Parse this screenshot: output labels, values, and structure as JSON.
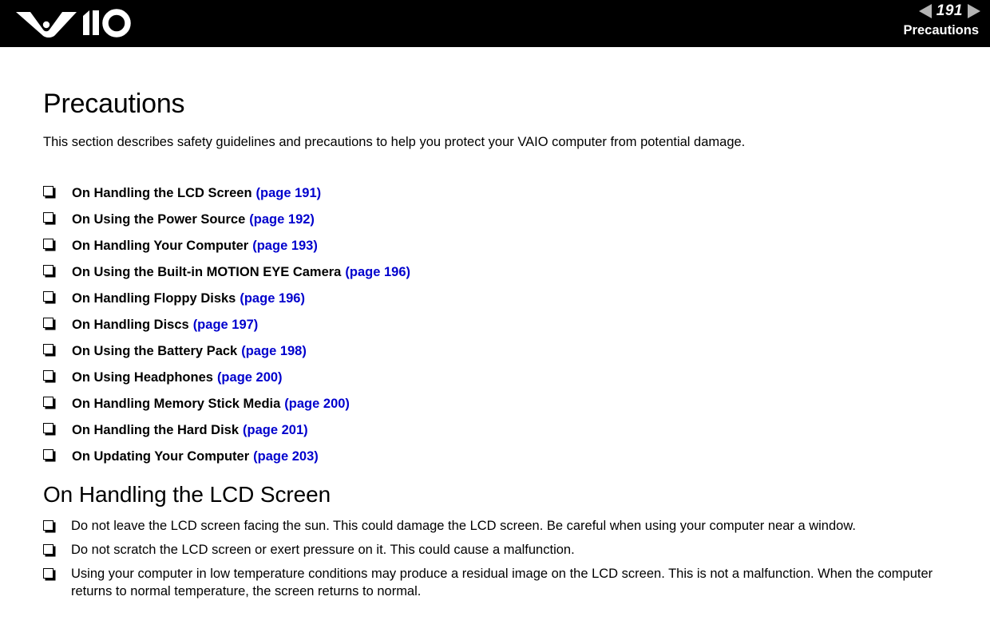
{
  "header": {
    "logo_alt": "VAIO",
    "prev_icon": "triangle-left-icon",
    "next_icon": "triangle-right-icon",
    "page_number": "191",
    "section_title": "Precautions",
    "background_color": "#000000",
    "arrow_color": "#b4b4b4",
    "text_color": "#ffffff"
  },
  "page": {
    "title": "Precautions",
    "intro": "This section describes safety guidelines and precautions to help you protect your VAIO computer from potential damage.",
    "link_color": "#0000cd",
    "bullet_icon": "hollow-square-bullet-icon"
  },
  "toc": {
    "items": [
      {
        "label": "On Handling the LCD Screen",
        "pageref": "(page 191)"
      },
      {
        "label": "On Using the Power Source",
        "pageref": "(page 192)"
      },
      {
        "label": "On Handling Your Computer",
        "pageref": "(page 193)"
      },
      {
        "label": "On Using the Built-in MOTION EYE Camera",
        "pageref": "(page 196)"
      },
      {
        "label": "On Handling Floppy Disks",
        "pageref": "(page 196)"
      },
      {
        "label": "On Handling Discs",
        "pageref": "(page 197)"
      },
      {
        "label": "On Using the Battery Pack",
        "pageref": "(page 198)"
      },
      {
        "label": "On Using Headphones",
        "pageref": "(page 200)"
      },
      {
        "label": "On Handling Memory Stick Media",
        "pageref": "(page 200)"
      },
      {
        "label": "On Handling the Hard Disk",
        "pageref": "(page 201)"
      },
      {
        "label": "On Updating Your Computer",
        "pageref": "(page 203)"
      }
    ]
  },
  "section": {
    "heading": "On Handling the LCD Screen",
    "bullets": [
      "Do not leave the LCD screen facing the sun. This could damage the LCD screen. Be careful when using your computer near a window.",
      "Do not scratch the LCD screen or exert pressure on it. This could cause a malfunction.",
      "Using your computer in low temperature conditions may produce a residual image on the LCD screen. This is not a malfunction. When the computer returns to normal temperature, the screen returns to normal."
    ]
  }
}
